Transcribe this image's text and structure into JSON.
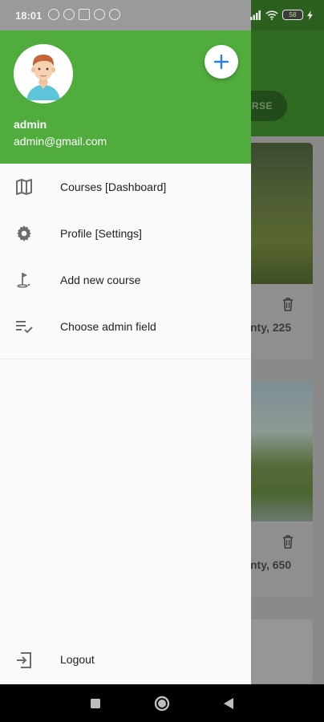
{
  "status_bar": {
    "time": "18:01",
    "battery": "58"
  },
  "drawer": {
    "user": {
      "name": "admin",
      "email": "admin@gmail.com"
    },
    "menu": [
      {
        "label": "Courses [Dashboard]",
        "icon": "map-icon"
      },
      {
        "label": "Profile [Settings]",
        "icon": "gear-icon"
      },
      {
        "label": "Add new course",
        "icon": "golf-flag-icon"
      },
      {
        "label": "Choose admin field",
        "icon": "checklist-icon"
      }
    ],
    "logout_label": "Logout"
  },
  "background": {
    "add_button_label": "RSE",
    "card1_text": "nty, 225",
    "card2_text": "nty, 650"
  },
  "colors": {
    "drawer_header": "#4fac3d",
    "fab_plus": "#2a7de1",
    "icon_gray": "#6d6d6d"
  }
}
